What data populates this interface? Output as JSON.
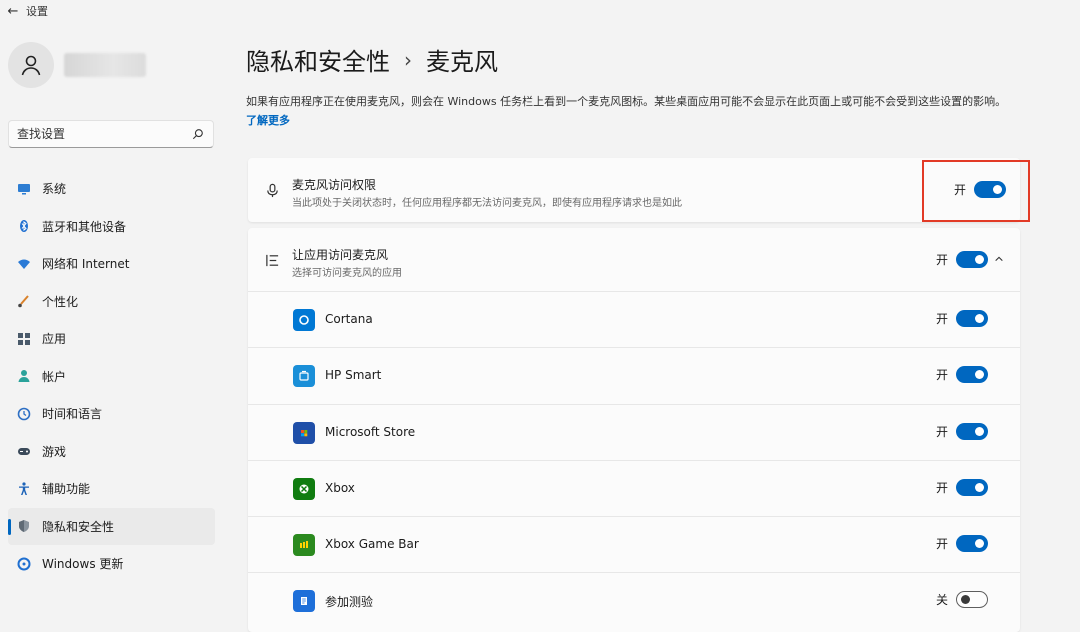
{
  "window": {
    "title": "设置"
  },
  "sidebar": {
    "search_placeholder": "查找设置",
    "items": [
      {
        "label": "系统",
        "icon": "monitor-icon",
        "active": false
      },
      {
        "label": "蓝牙和其他设备",
        "icon": "bluetooth-icon",
        "active": false
      },
      {
        "label": "网络和 Internet",
        "icon": "wifi-icon",
        "active": false
      },
      {
        "label": "个性化",
        "icon": "brush-icon",
        "active": false
      },
      {
        "label": "应用",
        "icon": "apps-icon",
        "active": false
      },
      {
        "label": "帐户",
        "icon": "person-icon",
        "active": false
      },
      {
        "label": "时间和语言",
        "icon": "clock-globe-icon",
        "active": false
      },
      {
        "label": "游戏",
        "icon": "gamepad-icon",
        "active": false
      },
      {
        "label": "辅助功能",
        "icon": "accessibility-icon",
        "active": false
      },
      {
        "label": "隐私和安全性",
        "icon": "shield-icon",
        "active": true
      },
      {
        "label": "Windows 更新",
        "icon": "update-icon",
        "active": false
      }
    ]
  },
  "main": {
    "breadcrumb": {
      "parent": "隐私和安全性",
      "separator": "›",
      "current": "麦克风"
    },
    "description": "如果有应用程序正在使用麦克风，则会在 Windows 任务栏上看到一个麦克风图标。某些桌面应用可能不会显示在此页面上或可能不会受到这些设置的影响。",
    "learn_more": "了解更多",
    "master": {
      "title": "麦克风访问权限",
      "subtitle": "当此项处于关闭状态时，任何应用程序都无法访问麦克风，即使有应用程序请求也是如此",
      "state_label": "开",
      "on": true
    },
    "group": {
      "title": "让应用访问麦克风",
      "subtitle": "选择可访问麦克风的应用",
      "state_label": "开",
      "on": true,
      "apps": [
        {
          "name": "Cortana",
          "icon": "cortana-icon",
          "color": "#0078d4",
          "state_label": "开",
          "on": true
        },
        {
          "name": "HP Smart",
          "icon": "hp-smart-icon",
          "color": "#1a8fd8",
          "state_label": "开",
          "on": true
        },
        {
          "name": "Microsoft Store",
          "icon": "store-icon",
          "color": "#1f4fa8",
          "state_label": "开",
          "on": true
        },
        {
          "name": "Xbox",
          "icon": "xbox-icon",
          "color": "#107c10",
          "state_label": "开",
          "on": true
        },
        {
          "name": "Xbox Game Bar",
          "icon": "game-bar-icon",
          "color": "#2b8a1f",
          "state_label": "开",
          "on": true
        },
        {
          "name": "参加测验",
          "icon": "take-a-test-icon",
          "color": "#1e6fd9",
          "state_label": "关",
          "on": false
        }
      ]
    }
  },
  "colors": {
    "accent": "#0067c0",
    "highlight_box": "#e23a26"
  }
}
